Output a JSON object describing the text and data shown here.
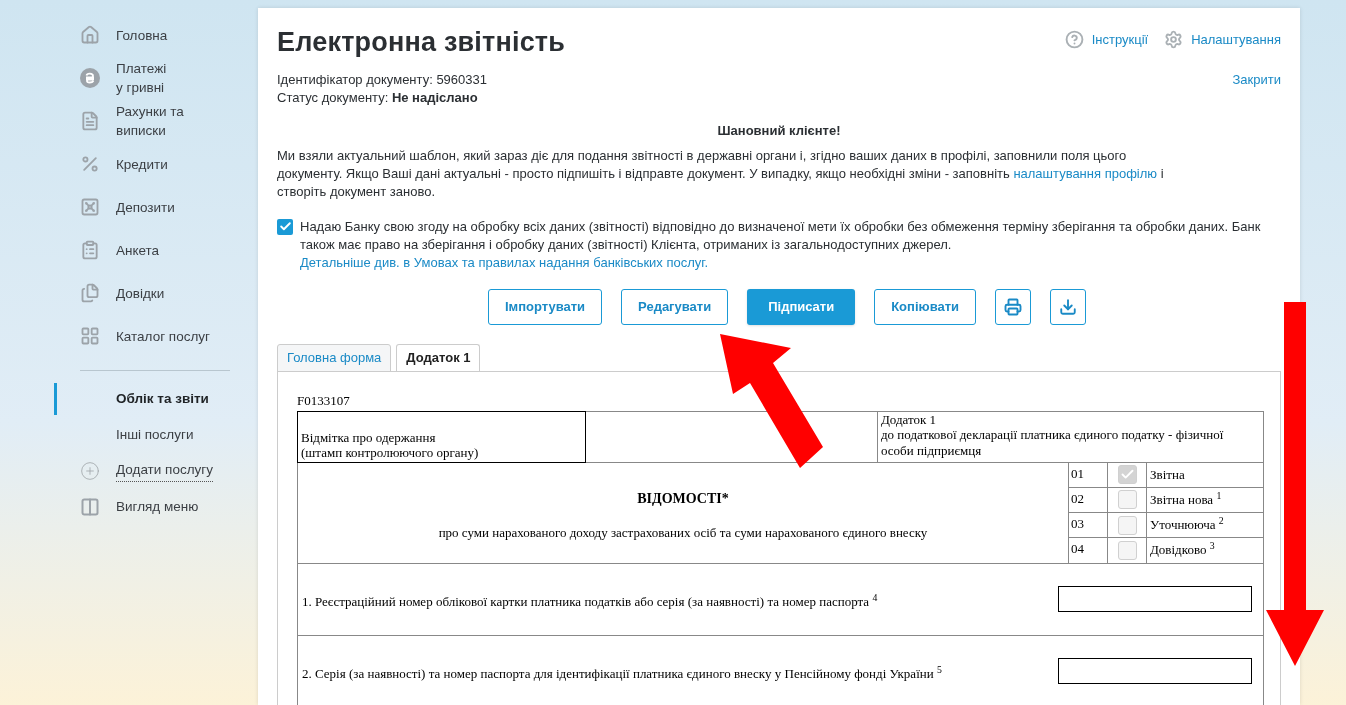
{
  "sidebar": {
    "main_items": [
      {
        "label": "Головна"
      },
      {
        "label": "Платежі\nу гривні"
      },
      {
        "label": "Рахунки та\nвиписки"
      },
      {
        "label": "Кредити"
      },
      {
        "label": "Депозити"
      },
      {
        "label": "Анкета"
      },
      {
        "label": "Довідки"
      },
      {
        "label": "Каталог послуг"
      }
    ],
    "sub_items": [
      {
        "label": "Облік та звіти",
        "kind": "section",
        "selected": true
      },
      {
        "label": "Інші послуги",
        "kind": "section",
        "selected": false
      },
      {
        "label": "Додати послугу",
        "kind": "add",
        "selected": false
      },
      {
        "label": "Вигляд меню",
        "kind": "view",
        "selected": false
      }
    ]
  },
  "header": {
    "title": "Електронна звітність",
    "links": [
      {
        "label": "Інструкції",
        "kind": "help"
      },
      {
        "label": "Налаштування",
        "kind": "settings"
      }
    ]
  },
  "document": {
    "id_line": "Ідентифікатор документу: 5960331",
    "status_line": "Статус документу: **Не надіслано**",
    "close_link": "Закрити"
  },
  "notice": {
    "heading": "Шановний клієнте!",
    "text_before": "Ми взяли актуальний шаблон, який зараз діє для подання звітності в державні органи і, згідно ваших даних в профілі, заповнили поля цього документу. Якщо Ваші дані актуальні - просто підпишіть і відправте документ. У випадку, якщо необхідні зміни - заповніть ",
    "link": "налаштування профілю",
    "text_after": " і створіть документ заново."
  },
  "consent": {
    "checked": true,
    "text": "Надаю Банку свою згоду на обробку всіх даних (звітності) відповідно до визначеної мети їх обробки без обмеження терміну зберігання та обробки даних. Банк також має право на зберігання і обробку даних (звітності) Клієнта, отриманих із загальнодоступних джерел. ",
    "link": "Детальніше див. в Умовах та правилах надання банківських послуг."
  },
  "buttons": [
    {
      "label": "Імпортувати",
      "kind": "outline"
    },
    {
      "label": "Редагувати",
      "kind": "outline"
    },
    {
      "label": "Підписати",
      "kind": "primary"
    },
    {
      "label": "Копіювати",
      "kind": "outline"
    },
    {
      "kind": "print"
    },
    {
      "kind": "download"
    }
  ],
  "tabs": [
    {
      "label": "Головна форма",
      "selected": false
    },
    {
      "label": "Додаток 1",
      "selected": true
    }
  ],
  "form": {
    "code": "F0133107",
    "stamp": "Відмітка про одержання\n(штамп контролюючого органу)",
    "annex": "Додаток 1\nдо податкової декларації платника єдиного податку - фізичної\nособи підприємця",
    "title": "ВІДОМОСТІ*",
    "subtitle": "про суми нарахованого доходу застрахованих осіб та суми нарахованого єдиного внеску",
    "report_types": [
      {
        "code": "01",
        "label": "Звітна",
        "checked": true
      },
      {
        "code": "02",
        "label": "Звітна нова $^{1}$",
        "checked": false
      },
      {
        "code": "03",
        "label": "Уточнююча $^{2}$",
        "checked": false
      },
      {
        "code": "04",
        "label": "Довідково $^{3}$",
        "checked": false
      }
    ],
    "fields": [
      {
        "label": "1. Реєстраційний номер облікової картки платника податків або серія (за наявності) та номер паспорта $^{4}$"
      },
      {
        "label": "2. Серія (за наявності) та номер паспорта для ідентифікації платника єдиного внеску у Пенсійному фонді України $^{5}$"
      }
    ]
  }
}
